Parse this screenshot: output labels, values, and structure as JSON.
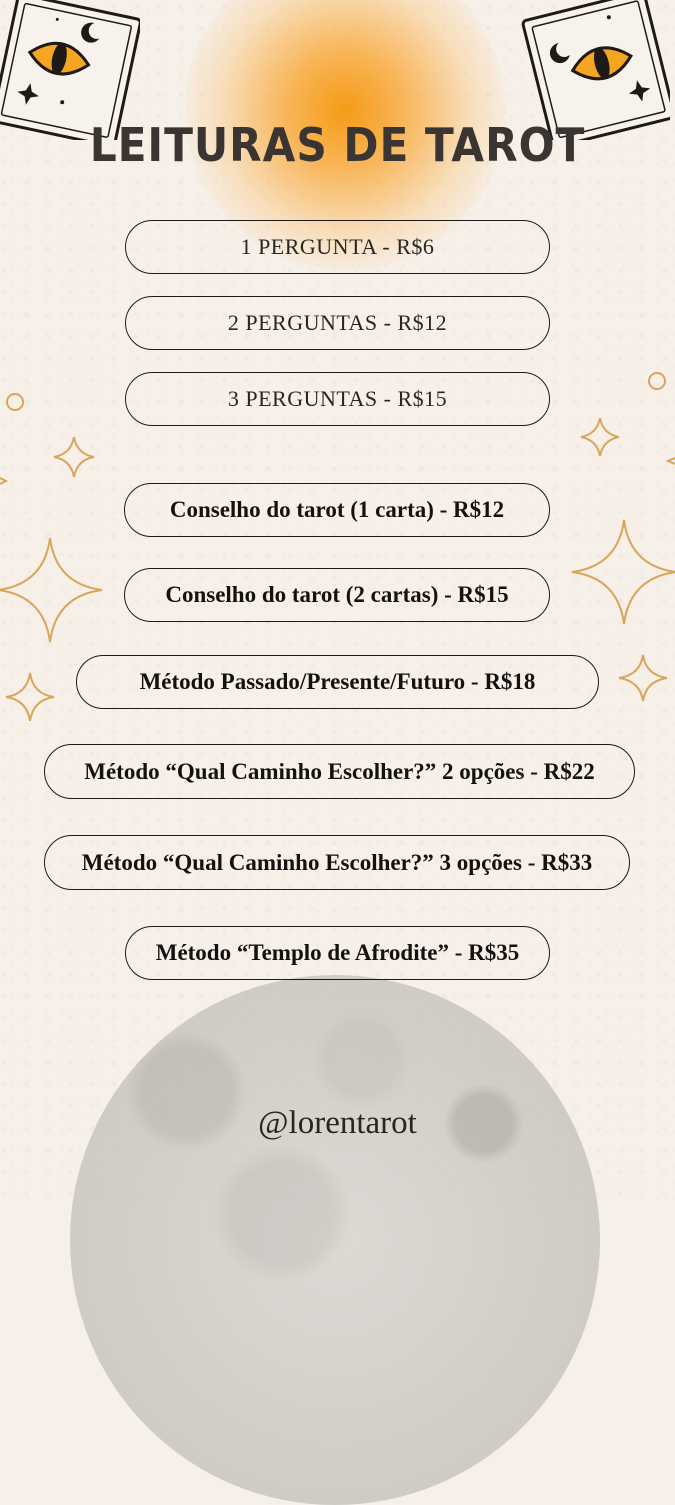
{
  "title": "LEITURAS DE TAROT",
  "options": [
    "1 PERGUNTA - R$6",
    "2 PERGUNTAS - R$12",
    "3 PERGUNTAS - R$15",
    "Conselho do tarot (1 carta) - R$12",
    "Conselho do tarot (2 cartas) - R$15",
    "Método Passado/Presente/Futuro - R$18",
    "Método “Qual Caminho Escolher?” 2 opções - R$22",
    "Método “Qual Caminho Escolher?” 3 opções - R$33",
    "Método “Templo de Afrodite” - R$35"
  ],
  "handle": "@lorentarot",
  "colors": {
    "accent": "#f69b16",
    "gold": "#d9a55a",
    "background": "#f6f0e9"
  },
  "icons": [
    "tarot-card-eye-icon",
    "sparkle-star-icon",
    "circle-icon",
    "moon-image"
  ]
}
